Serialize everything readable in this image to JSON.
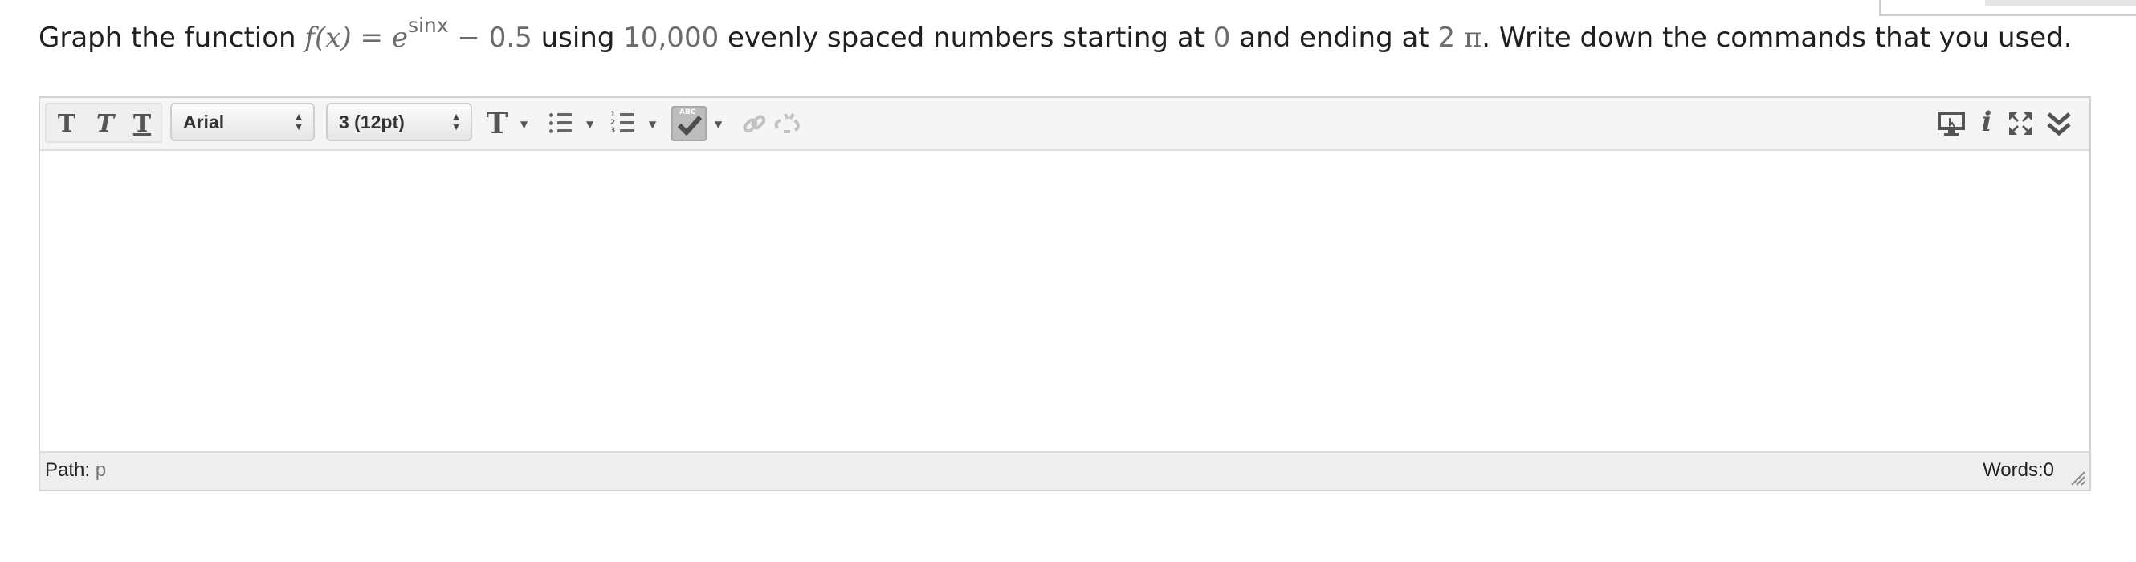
{
  "question": {
    "text_graph": "Graph the function ",
    "f_of_x": "f(x)",
    "equals": "=",
    "e": "e",
    "exponent": "sinx",
    "minus": "− ",
    "constant": "0.5",
    "text_using": " using ",
    "count": "10,000",
    "text_evenly": " evenly spaced numbers starting at ",
    "start": "0",
    "text_ending": " and ending at ",
    "end": "2",
    "pi": "π",
    "text_rest": ". Write down the commands that you used."
  },
  "toolbar": {
    "bold_glyph": "T",
    "italic_glyph": "T",
    "underline_glyph": "T",
    "font_family": "Arial",
    "font_size": "3 (12pt)",
    "format_glyph": "T",
    "spellcheck_label": "ABC"
  },
  "statusbar": {
    "path_label": "Path:",
    "path_value": "p",
    "words_label": "Words:0"
  },
  "colors": {
    "math_gray": "#6b6b6b",
    "toolbar_bg": "#f5f5f5",
    "status_bg": "#eeeeee"
  },
  "icons": [
    "bold-icon",
    "italic-icon",
    "underline-icon",
    "text-format-icon",
    "bullet-list-icon",
    "numbered-list-icon",
    "spellcheck-icon",
    "link-icon",
    "unlink-icon",
    "preview-icon",
    "info-icon",
    "fullscreen-icon",
    "collapse-toolbar-icon"
  ]
}
